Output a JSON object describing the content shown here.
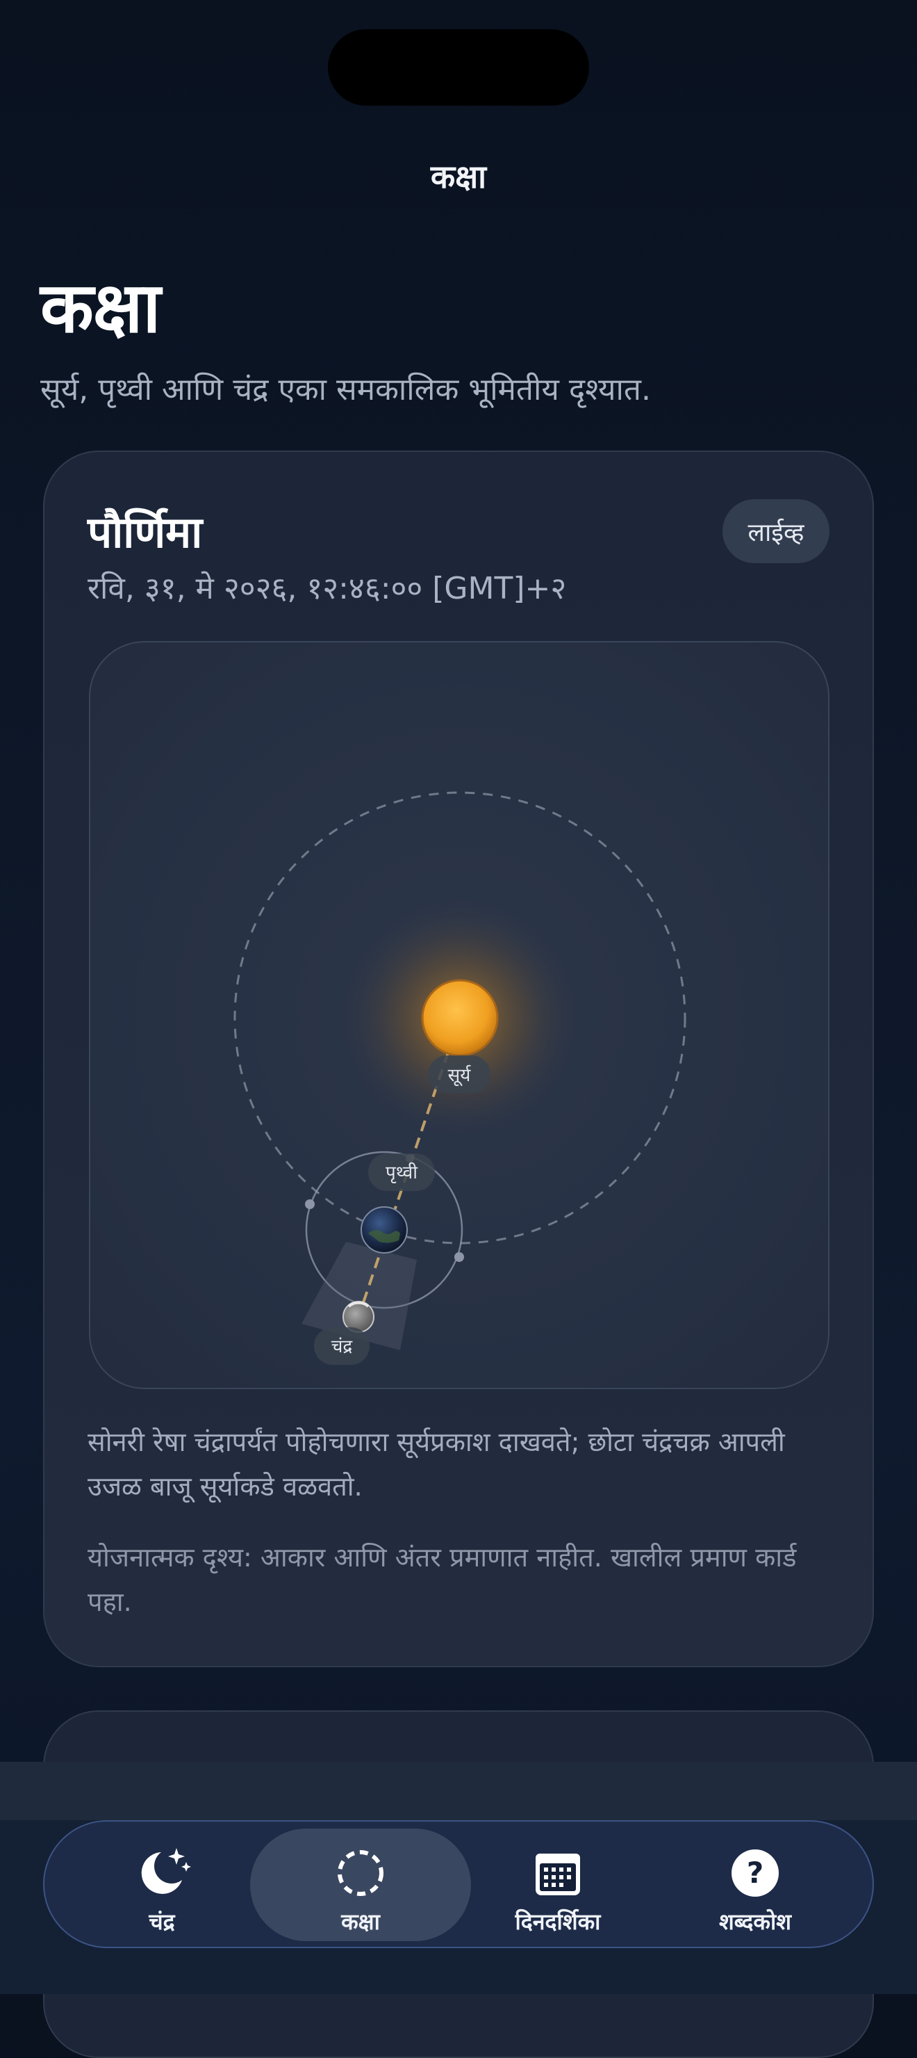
{
  "nav": {
    "title": "कक्षा"
  },
  "page": {
    "title": "कक्षा",
    "subtitle": "सूर्य, पृथ्वी आणि चंद्र एका समकालिक भूमितीय दृश्यात."
  },
  "card": {
    "title": "पौर्णिमा",
    "date": "रवि, ३१, मे २०२६, १२:४६:०० [GMT]+२",
    "badge": "लाईव्ह",
    "diagram": {
      "sun_label": "सूर्य",
      "earth_label": "पृथ्वी",
      "moon_label": "चंद्र"
    },
    "description": "सोनरी रेषा चंद्रापर्यंत पोहोचणारा सूर्यप्रकाश दाखवते; छोटा चंद्रचक्र आपली उजळ बाजू सूर्याकडे वळवतो.",
    "note": "योजनात्मक दृश्य: आकार आणि अंतर प्रमाणात नाहीत. खालील प्रमाण कार्ड पहा."
  },
  "tabs": [
    {
      "label": "चंद्र",
      "icon": "moon-stars-icon"
    },
    {
      "label": "कक्षा",
      "icon": "orbit-icon"
    },
    {
      "label": "दिनदर्शिका",
      "icon": "calendar-icon"
    },
    {
      "label": "शब्दकोश",
      "icon": "question-icon"
    }
  ],
  "colors": {
    "accent": "#f0a52a",
    "background": "#0d1728",
    "card": "#1f293b"
  }
}
